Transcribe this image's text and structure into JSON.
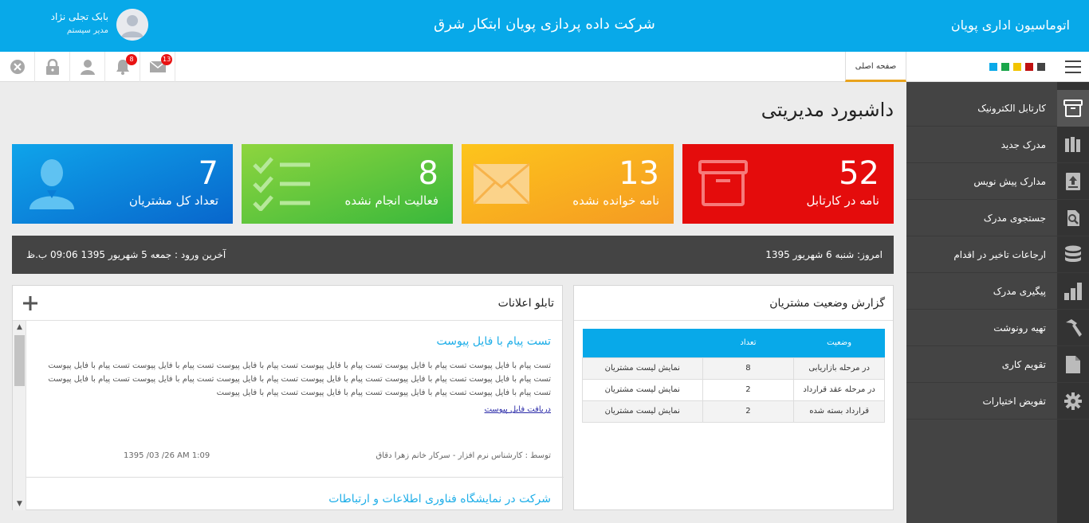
{
  "header": {
    "brand": "اتوماسیون اداری پویان",
    "company": "شرکت داده پردازی پویان ابتکار شرق",
    "user_name": "بابک تجلی نژاد",
    "user_role": "مدیر سیستم"
  },
  "toolbar": {
    "mail_count": "13",
    "notif_count": "8",
    "home_tab": "صفحه اصلی",
    "swatches": [
      "#0aa9e9",
      "#1aa64a",
      "#f2c400",
      "#c01010",
      "#444444"
    ]
  },
  "sidebar": {
    "items": [
      {
        "label": "کارتابل الکترونیک",
        "icon": "archive-box-icon"
      },
      {
        "label": "مدرک جدید",
        "icon": "books-icon"
      },
      {
        "label": "مدارک پیش نویس",
        "icon": "upload-doc-icon"
      },
      {
        "label": "جستجوی مدرک",
        "icon": "search-doc-icon"
      },
      {
        "label": "ارجاعات تاخیر در اقدام",
        "icon": "database-icon"
      },
      {
        "label": "پیگیری مدرک",
        "icon": "chart-blocks-icon"
      },
      {
        "label": "تهیه رونوشت",
        "icon": "hammer-icon"
      },
      {
        "label": "تقویم کاری",
        "icon": "document-icon"
      },
      {
        "label": "تفویض اختیارات",
        "icon": "gear-icon"
      }
    ]
  },
  "main": {
    "title": "داشبورد مدیریتی",
    "tiles": [
      {
        "value": "52",
        "label": "نامه در کارتابل",
        "color": "#e40c0c"
      },
      {
        "value": "13",
        "label": "نامه خوانده نشده",
        "color": "#f7a324"
      },
      {
        "value": "8",
        "label": "فعالیت انجام نشده",
        "color": "#4cc13c"
      },
      {
        "value": "7",
        "label": "تعداد کل مشتریان",
        "color": "#0a86d8"
      }
    ],
    "today": "امروز: شنبه 6 شهریور 1395",
    "last_login": "آخرین ورود : جمعه 5 شهریور 1395 09:06 ب.ظ"
  },
  "report": {
    "title": "گزارش وضعیت مشتریان",
    "headers": [
      "وضعیت",
      "تعداد",
      ""
    ],
    "rows": [
      {
        "status": "در مرحله بازاریابی",
        "count": "8",
        "action": "نمایش لیست مشتریان"
      },
      {
        "status": "در مرحله عقد قرارداد",
        "count": "2",
        "action": "نمایش لیست مشتریان"
      },
      {
        "status": "قرارداد بسته شده",
        "count": "2",
        "action": "نمایش لیست مشتریان"
      }
    ]
  },
  "board": {
    "title": "تابلو اعلانات",
    "items": [
      {
        "title": "تست پیام با فایل پیوست",
        "body": "تست پیام با فایل پیوست تست پیام با فایل پیوست تست پیام با فایل پیوست تست پیام با فایل پیوست تست پیام با فایل پیوست تست پیام با فایل پیوست تست پیام با فایل پیوست تست پیام با فایل پیوست تست پیام با فایل پیوست تست پیام با فایل پیوست تست پیام با فایل پیوست تست پیام با فایل پیوست تست پیام با فایل پیوست تست پیام با فایل پیوست تست پیام با فایل پیوست تست پیام با فایل پیوست",
        "link": "دریافت فایل پیوست",
        "author": "توسط : کارشناس نرم افزار - سرکار خانم زهرا دقاق",
        "date": "1395 /03 /26 AM 1:09"
      },
      {
        "title": "شرکت در نمایشگاه فناوری اطلاعات و ارتباطات"
      }
    ]
  }
}
